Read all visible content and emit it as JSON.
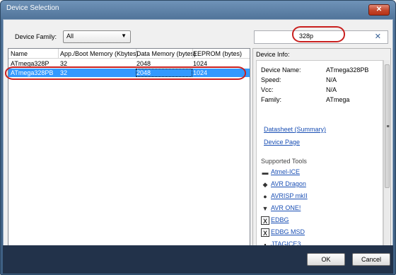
{
  "window": {
    "title": "Device Selection",
    "close_glyph": "✕"
  },
  "filter": {
    "family_label": "Device Family:",
    "family_value": "All",
    "search_value": "328p",
    "clear_glyph": "✕"
  },
  "table": {
    "headers": [
      "Name",
      "App./Boot Memory (Kbytes)",
      "Data Memory (bytes)",
      "EEPROM (bytes)"
    ],
    "rows": [
      {
        "name": "ATmega328P",
        "app": "32",
        "data": "2048",
        "eeprom": "1024"
      },
      {
        "name": "ATmega328PB",
        "app": "32",
        "data": "2048",
        "eeprom": "1024"
      }
    ]
  },
  "info": {
    "title": "Device Info:",
    "fields": [
      {
        "label": "Device Name:",
        "value": "ATmega328PB"
      },
      {
        "label": "Speed:",
        "value": "N/A"
      },
      {
        "label": "Vcc:",
        "value": "N/A"
      },
      {
        "label": "Family:",
        "value": "ATmega"
      }
    ],
    "links": [
      "Datasheet (Summary)",
      "Device Page"
    ],
    "tools_title": "Supported Tools",
    "tools": [
      {
        "label": "Atmel-ICE",
        "icon": "atmel-ice-icon",
        "glyph": "▬"
      },
      {
        "label": "AVR Dragon",
        "icon": "avr-dragon-icon",
        "glyph": "◆"
      },
      {
        "label": "AVRISP mkII",
        "icon": "avrisp-icon",
        "glyph": "●"
      },
      {
        "label": "AVR ONE!",
        "icon": "avr-one-icon",
        "glyph": "▼"
      },
      {
        "label": "EDBG",
        "icon": "edbg-icon",
        "glyph": "X"
      },
      {
        "label": "EDBG MSD",
        "icon": "edbg-msd-icon",
        "glyph": "X"
      },
      {
        "label": "JTAGICE3",
        "icon": "jtagice3-icon",
        "glyph": "▪"
      }
    ]
  },
  "buttons": {
    "ok": "OK",
    "cancel": "Cancel"
  },
  "colors": {
    "selection": "#3399ff",
    "highlight_oval": "#c9201f",
    "link": "#1a4fb4"
  }
}
